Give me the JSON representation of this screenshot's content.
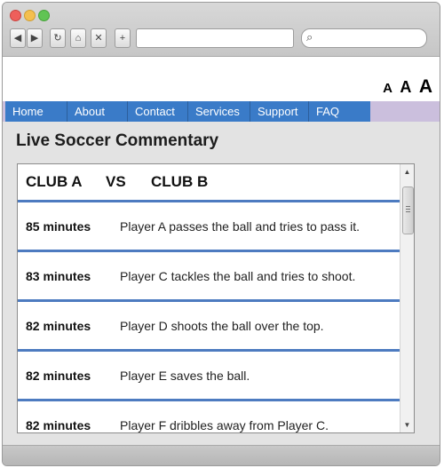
{
  "browser": {
    "buttons": {
      "back": "◀",
      "forward": "▶",
      "reload": "↻",
      "home": "⌂",
      "stop": "✕",
      "new_tab": "+"
    },
    "search_icon": "⌕"
  },
  "font_size_controls": [
    "A",
    "A",
    "A"
  ],
  "nav": {
    "items": [
      {
        "label": "Home"
      },
      {
        "label": "About"
      },
      {
        "label": "Contact"
      },
      {
        "label": "Services"
      },
      {
        "label": "Support"
      },
      {
        "label": "FAQ"
      }
    ]
  },
  "main": {
    "title": "Live Soccer Commentary",
    "match": {
      "home": "CLUB A",
      "vs": "VS",
      "away": "CLUB B"
    },
    "events": [
      {
        "minute": "85 minutes",
        "text": "Player A passes the ball and tries to pass it."
      },
      {
        "minute": "83 minutes",
        "text": "Player C tackles the ball and tries to shoot."
      },
      {
        "minute": "82 minutes",
        "text": "Player D shoots the ball over the top."
      },
      {
        "minute": "82 minutes",
        "text": "Player E saves the ball."
      },
      {
        "minute": "82 minutes",
        "text": "Player F dribbles away from Player C."
      }
    ]
  },
  "colors": {
    "nav_blue": "#3a7bc8",
    "row_divider": "#4d7bc0",
    "nav_tail": "#cbbfdd"
  }
}
